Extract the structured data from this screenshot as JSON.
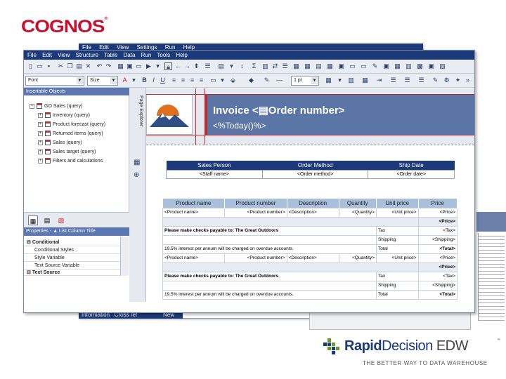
{
  "brand": {
    "cognos": "COGNOS",
    "cognos_mark": "®"
  },
  "back_window": {
    "menu": [
      "File",
      "Edit",
      "View",
      "Settings",
      "Run",
      "Help"
    ],
    "bottom_tabs": [
      "Information",
      "Cross ref"
    ],
    "bottom_tab2": "New"
  },
  "main_window": {
    "menu": [
      "File",
      "Edit",
      "View",
      "Structure",
      "Table",
      "Data",
      "Run",
      "Tools",
      "Help"
    ],
    "font_combo": "Font",
    "size_combo": "Size",
    "line_width": "1 pt",
    "insertable_objects_title": "Insertable Objects",
    "tree": {
      "root": "GO Sales (query)",
      "items": [
        "Inventory (query)",
        "Product forecast (query)",
        "Returned items (query)",
        "Sales (query)",
        "Sales target (query)",
        "Filters and calculations"
      ]
    },
    "properties_title": "Properties - ",
    "properties_sub": "List Column Title",
    "properties": [
      {
        "label": "Conditional",
        "section": true
      },
      {
        "label": "Conditional Styles",
        "section": false
      },
      {
        "label": "Style Variable",
        "section": false
      },
      {
        "label": "Text Source Variable",
        "section": false
      },
      {
        "label": "Text Source",
        "section": true
      }
    ],
    "page_explorer": "Page Explorer"
  },
  "report": {
    "invoice_title": "Invoice  <▤Order number>",
    "today": "<%Today()%>",
    "sales_headers": [
      "Sales Person",
      "Order Method",
      "Ship Date"
    ],
    "sales_row": [
      "<Staff name>",
      "<Order method>",
      "<Order date>"
    ],
    "product_headers": [
      "Product name",
      "Product number",
      "Description",
      "Quantity",
      "Unit price",
      "Price"
    ],
    "product_row": [
      "<Product name>",
      "<Product number>",
      "<Description>",
      "<Quantity>",
      "<Unit price>",
      "<Price>"
    ],
    "price_total": "<Price>",
    "checks_note": "Please make checks payable to: The Great Outdoors",
    "interest_note": "19.5% interest per annum will be charged on overdue accounts.",
    "tax_label": "Tax",
    "tax_value": "<Tax>",
    "shipping_label": "Shipping",
    "shipping_value": "<Shipping>",
    "total_label": "Total",
    "total_value": "<Total>"
  },
  "rapid_decision": {
    "rapid": "Rapid",
    "decision": "Decision",
    "edw": " EDW",
    "tm": "™",
    "tagline": "THE BETTER WAY TO DATA WAREHOUSE"
  }
}
